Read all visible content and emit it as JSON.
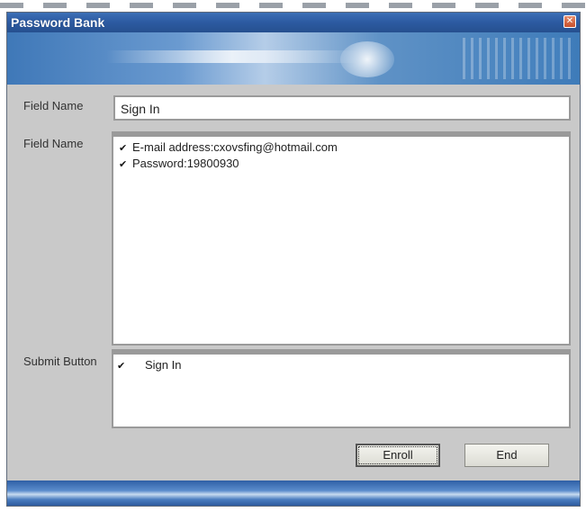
{
  "window": {
    "title": "Password Bank",
    "close_glyph": "✕"
  },
  "form": {
    "field_name_label": "Field Name",
    "field_name_value": "Sign In",
    "fields_label": "Field Name",
    "fields": [
      {
        "checked": true,
        "text": "E-mail address:cxovsfing@hotmail.com"
      },
      {
        "checked": true,
        "text": "Password:19800930"
      }
    ],
    "submit_label": "Submit Button",
    "submit_items": [
      {
        "checked": true,
        "text": "Sign In"
      }
    ]
  },
  "buttons": {
    "enroll_label": "Enroll",
    "end_label": "End"
  },
  "icons": {
    "check": "✔"
  }
}
